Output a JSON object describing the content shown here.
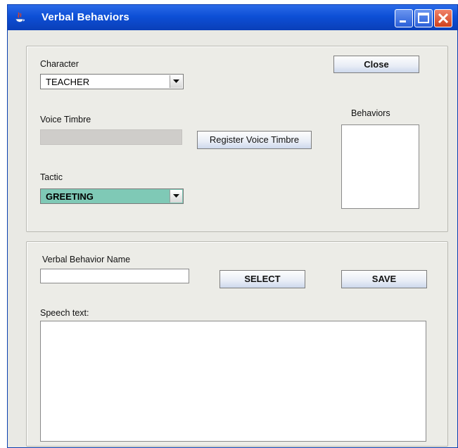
{
  "window": {
    "title": "Verbal Behaviors",
    "controls": {
      "minimize": "minimize-icon",
      "maximize": "maximize-icon",
      "close": "close-icon"
    }
  },
  "top_panel": {
    "character": {
      "label": "Character",
      "selected": "TEACHER"
    },
    "voice_timbre": {
      "label": "Voice Timbre",
      "value": ""
    },
    "register_button": "Register Voice Timbre",
    "tactic": {
      "label": "Tactic",
      "selected": "GREETING",
      "highlight_color": "#7fc9b6"
    },
    "close_button": "Close",
    "behaviors": {
      "label": "Behaviors",
      "items": []
    }
  },
  "bottom_panel": {
    "name_label": "Verbal Behavior Name",
    "name_value": "",
    "select_button": "SELECT",
    "save_button": "SAVE",
    "speech_label": "Speech text:",
    "speech_value": ""
  }
}
